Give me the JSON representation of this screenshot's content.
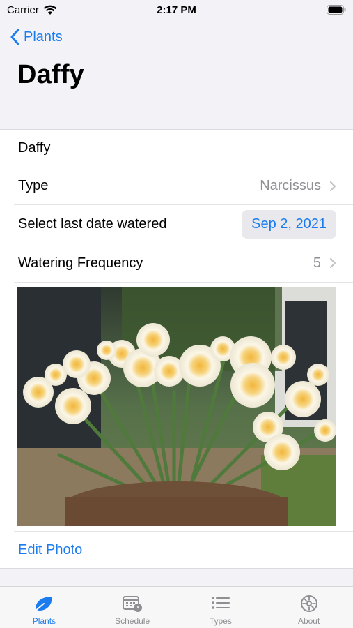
{
  "status_bar": {
    "carrier": "Carrier",
    "time": "2:17 PM"
  },
  "nav": {
    "back_label": "Plants",
    "title": "Daffy"
  },
  "form": {
    "name_value": "Daffy",
    "type_label": "Type",
    "type_value": "Narcissus",
    "date_label": "Select last date watered",
    "date_value": "Sep 2, 2021",
    "frequency_label": "Watering Frequency",
    "frequency_value": "5",
    "edit_photo_label": "Edit Photo"
  },
  "tabs": [
    {
      "label": "Plants",
      "icon": "leaf-icon",
      "active": true
    },
    {
      "label": "Schedule",
      "icon": "calendar-clock-icon",
      "active": false
    },
    {
      "label": "Types",
      "icon": "list-icon",
      "active": false
    },
    {
      "label": "About",
      "icon": "gear-icon",
      "active": false
    }
  ],
  "colors": {
    "accent": "#1b7cf0",
    "background": "#f2f2f7",
    "secondary_text": "#8e8e93"
  }
}
